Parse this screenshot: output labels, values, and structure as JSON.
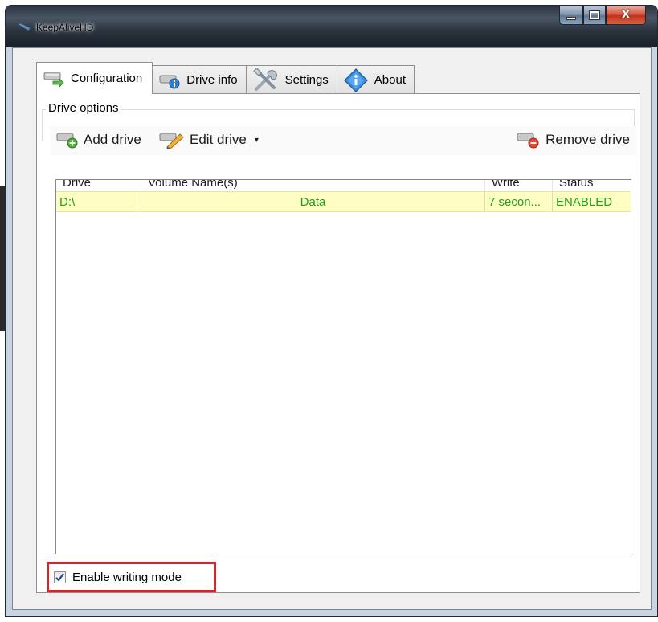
{
  "window": {
    "title": "KeepAliveHD",
    "close_label": "X"
  },
  "tabs": [
    {
      "label": "Configuration",
      "icon": "drive-arrow-icon",
      "active": true
    },
    {
      "label": "Drive info",
      "icon": "drive-info-icon",
      "active": false
    },
    {
      "label": "Settings",
      "icon": "tools-icon",
      "active": false
    },
    {
      "label": "About",
      "icon": "info-diamond-icon",
      "active": false
    }
  ],
  "drive_options": {
    "group_label": "Drive options",
    "toolbar": {
      "add_label": "Add drive",
      "edit_label": "Edit drive",
      "edit_arrow": "▾",
      "remove_label": "Remove drive"
    }
  },
  "drive_list": {
    "columns": [
      "Drive",
      "Volume Name(s)",
      "Write",
      "Status"
    ],
    "rows": [
      {
        "drive": "D:\\",
        "volume": "Data",
        "write": "7 secon...",
        "status": "ENABLED"
      }
    ],
    "row_color": "#289b1d"
  },
  "writing_mode": {
    "label": "Enable writing mode",
    "checked": true
  },
  "colors": {
    "highlight": "#d9232d",
    "row_background": "#fefdc3"
  }
}
